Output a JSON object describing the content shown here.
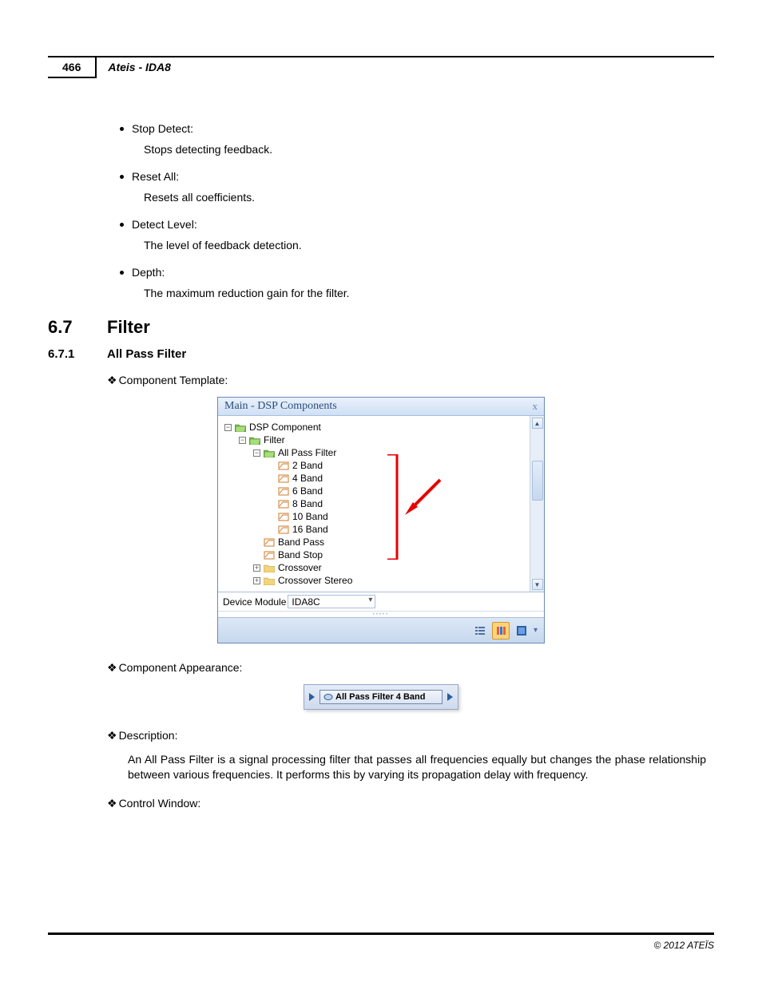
{
  "header": {
    "page_number": "466",
    "doc_title": "Ateis - IDA8"
  },
  "bullets": [
    {
      "title": "Stop Detect:",
      "desc": "Stops detecting feedback."
    },
    {
      "title": "Reset All:",
      "desc": "Resets all coefficients."
    },
    {
      "title": "Detect Level:",
      "desc": "The level of feedback detection."
    },
    {
      "title": "Depth:",
      "desc": "The maximum reduction gain for the filter."
    }
  ],
  "section": {
    "num": "6.7",
    "title": "Filter"
  },
  "subsection": {
    "num": "6.7.1",
    "title": "All Pass Filter"
  },
  "diamonds": {
    "component_template": "Component Template:",
    "component_appearance": "Component Appearance:",
    "description": "Description:",
    "control_window": "Control Window:"
  },
  "dsp_window": {
    "title": "Main - DSP Components",
    "tree": {
      "root": "DSP Component",
      "filter": "Filter",
      "allpass": "All Pass Filter",
      "bands": [
        "2 Band",
        "4 Band",
        "6 Band",
        "8 Band",
        "10 Band",
        "16 Band"
      ],
      "siblings": [
        "Band Pass",
        "Band Stop",
        "Crossover",
        "Crossover Stereo"
      ]
    },
    "device_label": "Device Module",
    "device_value": "IDA8C"
  },
  "appearance_block": {
    "label": "All Pass Filter 4 Band"
  },
  "description_text": "An All Pass Filter is a signal processing filter that passes all frequencies equally but changes the phase relationship between various frequencies. It performs this by varying its propagation delay with frequency.",
  "footer": "© 2012 ATEÏS"
}
